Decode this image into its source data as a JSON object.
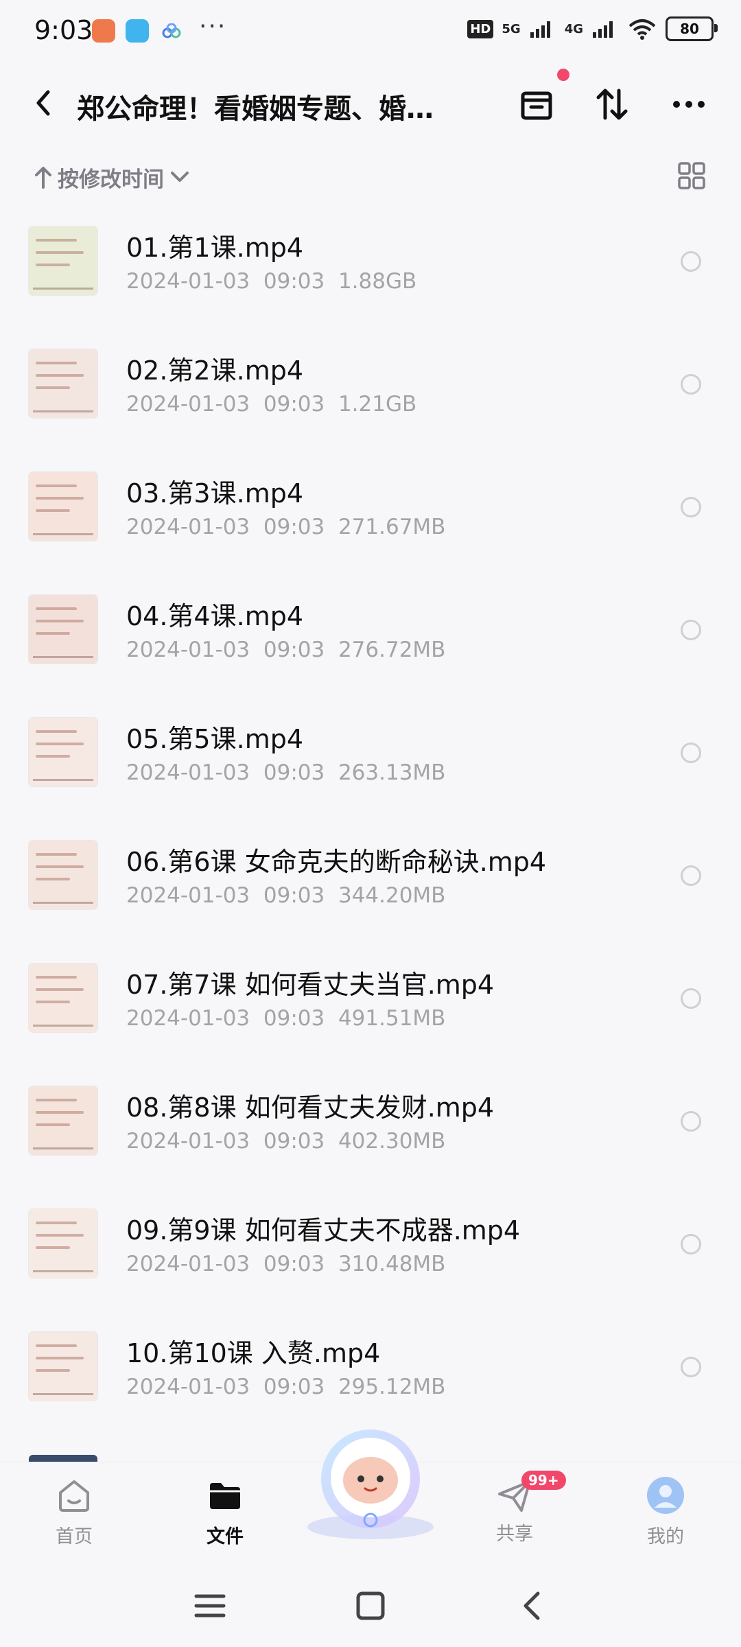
{
  "status_bar": {
    "time": "9:03",
    "hd": "HD",
    "net1": "5G",
    "net2": "4G",
    "battery": "80"
  },
  "header": {
    "title": "郑公命理！看婚姻专题、婚…",
    "notification_dot_color": "#f0476a"
  },
  "sort": {
    "label": "按修改时间"
  },
  "files": [
    {
      "name": "01.第1课.mp4",
      "date": "2024-01-03",
      "time": "09:03",
      "size": "1.88GB"
    },
    {
      "name": "02.第2课.mp4",
      "date": "2024-01-03",
      "time": "09:03",
      "size": "1.21GB"
    },
    {
      "name": "03.第3课.mp4",
      "date": "2024-01-03",
      "time": "09:03",
      "size": "271.67MB"
    },
    {
      "name": "04.第4课.mp4",
      "date": "2024-01-03",
      "time": "09:03",
      "size": "276.72MB"
    },
    {
      "name": "05.第5课.mp4",
      "date": "2024-01-03",
      "time": "09:03",
      "size": "263.13MB"
    },
    {
      "name": "06.第6课 女命克夫的断命秘诀.mp4",
      "date": "2024-01-03",
      "time": "09:03",
      "size": "344.20MB"
    },
    {
      "name": "07.第7课 如何看丈夫当官.mp4",
      "date": "2024-01-03",
      "time": "09:03",
      "size": "491.51MB"
    },
    {
      "name": "08.第8课 如何看丈夫发财.mp4",
      "date": "2024-01-03",
      "time": "09:03",
      "size": "402.30MB"
    },
    {
      "name": "09.第9课 如何看丈夫不成器.mp4",
      "date": "2024-01-03",
      "time": "09:03",
      "size": "310.48MB"
    },
    {
      "name": "10.第10课 入赘.mp4",
      "date": "2024-01-03",
      "time": "09:03",
      "size": "295.12MB"
    }
  ],
  "tabs": {
    "home": "首页",
    "files": "文件",
    "share": "共享",
    "share_badge": "99+",
    "me": "我的"
  },
  "colors": {
    "accent": "#f0476a",
    "muted_text": "#a3a3a8"
  }
}
